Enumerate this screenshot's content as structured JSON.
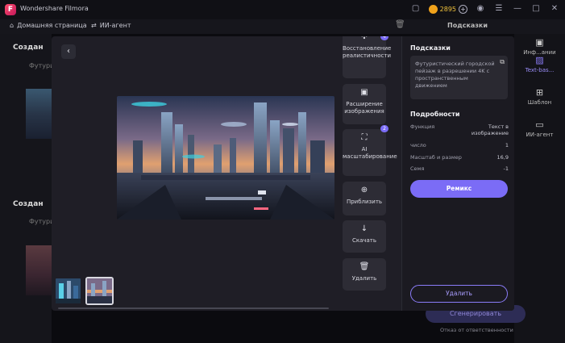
{
  "app": {
    "title": "Wondershare Filmora",
    "coins": "2895",
    "logo_letter": "F"
  },
  "nav": {
    "home": "Домашняя страница",
    "agent": "ИИ-агент"
  },
  "right_panel": {
    "header": "Подсказки",
    "items": [
      {
        "label": "Инф...ании",
        "icon": "image-icon"
      },
      {
        "label": "Text-bas...",
        "icon": "image-edit-icon"
      },
      {
        "label": "Шаблон",
        "icon": "grid-icon"
      },
      {
        "label": "ИИ-агент",
        "icon": "chat-icon"
      }
    ]
  },
  "background": {
    "section1": "Создан",
    "section1_sub": "Футури",
    "section2": "Создан",
    "section2_sub": "Футури"
  },
  "modal": {
    "tools": [
      {
        "label": "Восстановление реалистичности",
        "badge": "4",
        "icon": "restore-icon"
      },
      {
        "label": "Расширение изображения",
        "badge": "",
        "icon": "expand-icon"
      },
      {
        "label": "AI масштабирование",
        "badge": "2",
        "icon": "upscale-icon"
      },
      {
        "label": "Приблизить",
        "badge": "",
        "icon": "zoom-icon"
      },
      {
        "label": "Скачать",
        "badge": "",
        "icon": "download-icon"
      },
      {
        "label": "Удалить",
        "badge": "",
        "icon": "trash-icon"
      }
    ],
    "hints_title": "Подсказки",
    "prompt": "Футуристический городской пейзаж в разрешении 4K с пространственным движением",
    "details_title": "Подробности",
    "details": [
      {
        "key": "Функция",
        "value": "Текст в изображение"
      },
      {
        "key": "число",
        "value": "1"
      },
      {
        "key": "Масштаб и размер",
        "value": "16,9"
      },
      {
        "key": "Семя",
        "value": "-1"
      }
    ],
    "remix_label": "Ремикс",
    "delete_label": "Удалить"
  },
  "bottom": {
    "generate_label": "Сгенерировать",
    "footer": "Отказ от ответственности"
  },
  "colors": {
    "accent": "#7b6cf6",
    "background": "#121217",
    "panel": "#1f1e26"
  }
}
